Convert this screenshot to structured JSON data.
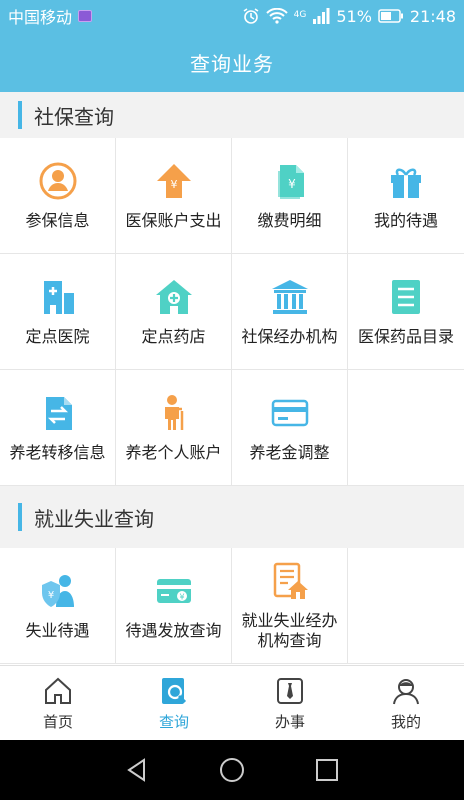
{
  "status": {
    "carrier": "中国移动",
    "network": "4G",
    "battery": "51%",
    "time": "21:48"
  },
  "title": "查询业务",
  "sections": [
    {
      "title": "社保查询",
      "items": [
        {
          "label": "参保信息",
          "icon": "person-circle-icon"
        },
        {
          "label": "医保账户支出",
          "icon": "yuan-up-arrow-icon"
        },
        {
          "label": "缴费明细",
          "icon": "yuan-document-icon"
        },
        {
          "label": "我的待遇",
          "icon": "gift-icon"
        },
        {
          "label": "定点医院",
          "icon": "hospital-icon"
        },
        {
          "label": "定点药店",
          "icon": "pharmacy-icon"
        },
        {
          "label": "社保经办机构",
          "icon": "bank-icon"
        },
        {
          "label": "医保药品目录",
          "icon": "list-icon"
        },
        {
          "label": "养老转移信息",
          "icon": "transfer-document-icon"
        },
        {
          "label": "养老个人账户",
          "icon": "elderly-person-icon"
        },
        {
          "label": "养老金调整",
          "icon": "card-icon"
        }
      ]
    },
    {
      "title": "就业失业查询",
      "items": [
        {
          "label": "失业待遇",
          "icon": "person-shield-icon"
        },
        {
          "label": "待遇发放查询",
          "icon": "yuan-card-icon"
        },
        {
          "label": "就业失业经办机构查询",
          "icon": "house-document-icon"
        }
      ]
    }
  ],
  "tabs": [
    {
      "label": "首页",
      "icon": "home-icon",
      "active": false
    },
    {
      "label": "查询",
      "icon": "search-doc-icon",
      "active": true
    },
    {
      "label": "办事",
      "icon": "tie-icon",
      "active": false
    },
    {
      "label": "我的",
      "icon": "user-icon",
      "active": false
    }
  ],
  "colors": {
    "primary": "#5bbfe3",
    "orange": "#f5a04a",
    "teal": "#4fd1c5",
    "blue": "#46b6e6"
  }
}
